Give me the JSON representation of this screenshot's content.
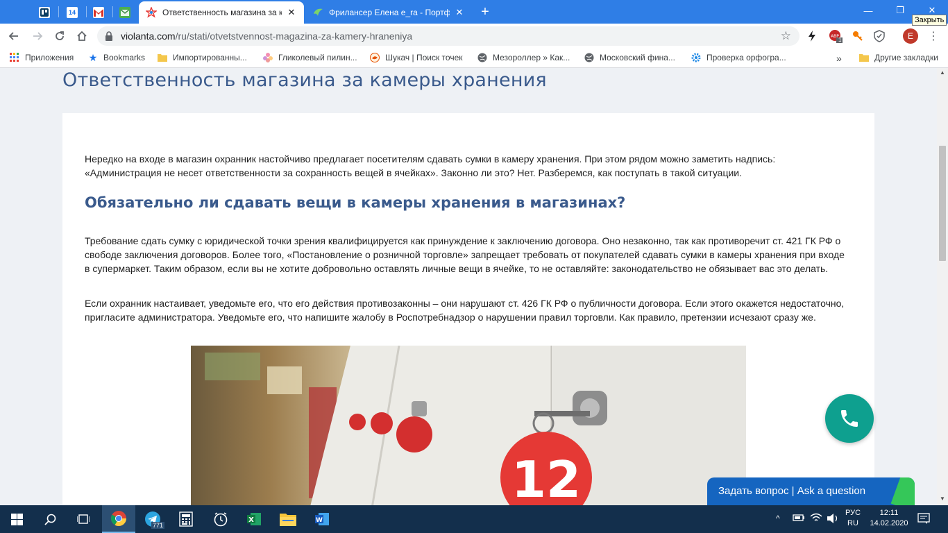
{
  "browser": {
    "tabs": [
      {
        "title": "Ответственность магазина за к",
        "active": true
      },
      {
        "title": "Фрилансер Елена e_ra - Портфо",
        "active": false
      }
    ],
    "pinned_badge": "14",
    "close_tooltip": "Закрыть",
    "url_host": "violanta.com",
    "url_path": "/ru/stati/otvetstvennost-magazina-za-kamery-hraneniya",
    "ext_badge": "1",
    "profile_initial": "E"
  },
  "bookmarks": {
    "items": [
      "Приложения",
      "Bookmarks",
      "Импортированны...",
      "Гликолевый пилин...",
      "Шукач | Поиск точек",
      "Мезороллер » Как...",
      "Московский фина...",
      "Проверка орфогра..."
    ],
    "overflow": "»",
    "other": "Другие закладки"
  },
  "article": {
    "title": "Ответственность магазина за камеры хранения",
    "intro": "Нередко на входе в магазин охранник настойчиво предлагает посетителям сдавать сумки в камеру хранения. При этом рядом можно заметить надпись: «Администрация не несет ответственности за сохранность вещей в ячейках». Законно ли это? Нет. Разберемся, как поступать в такой ситуации.",
    "h2": "Обязательно ли сдавать вещи в камеры хранения в магазинах?",
    "p1": "Требование сдать сумку с юридической точки зрения квалифицируется как принуждение к заключению договора. Оно незаконно, так как противоречит ст. 421 ГК РФ о свободе заключения договоров. Более того, «Постановление о розничной торговле» запрещает требовать от покупателей сдавать сумки в камеры хранения при входе в супермаркет. Таким образом, если вы не хотите добровольно оставлять личные вещи в ячейке, то не оставляйте: законодательство не обязывает вас это делать.",
    "p2": "Если охранник настаивает, уведомьте его, что его действия противозаконны – они нарушают ст. 426 ГК РФ о публичности договора. Если этого окажется недостаточно, пригласите администратора. Уведомьте его, что напишите жалобу в Роспотребнадзор о нарушении правил торговли. Как правило, претензии исчезают сразу же.",
    "photo_tag_number": "12"
  },
  "widgets": {
    "ask_label": "Задать вопрос | Ask a question"
  },
  "taskbar": {
    "telegram_badge": "771",
    "lang_top": "РУС",
    "lang_bottom": "RU",
    "time": "12:11",
    "date": "14.02.2020"
  },
  "colors": {
    "tabstrip": "#2f7ee6",
    "heading": "#3a5a8c",
    "call_button": "#0ea08f",
    "ask_button": "#1565c0",
    "taskbar": "#132f4c"
  }
}
